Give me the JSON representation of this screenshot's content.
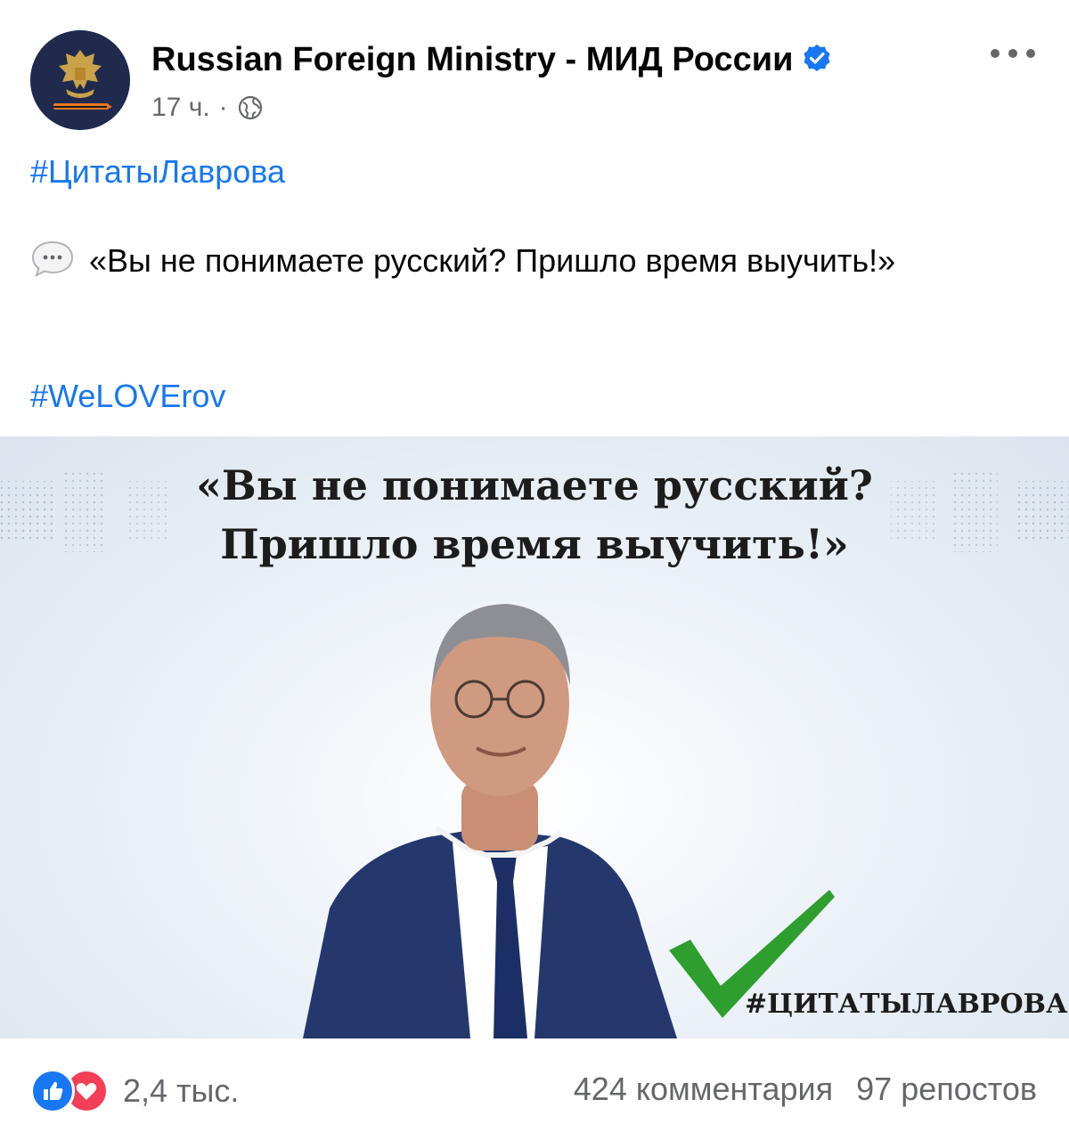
{
  "post": {
    "author": "Russian Foreign Ministry - МИД России",
    "verified": true,
    "timestamp": "17 ч.",
    "separator": "·",
    "audience_icon": "globe-icon",
    "hashtag_top": "#ЦитатыЛаврова",
    "quote_text": "«Вы не понимаете русский? Пришло время выучить!»",
    "hashtag_bottom": "#WeLOVErov"
  },
  "image": {
    "quote_line1": "«Вы не понимаете русский?",
    "quote_line2": "Пришло время выучить!»",
    "hashtag": "#ЦИТАТЫЛАВРОВА",
    "check_color": "#2e9e2e"
  },
  "footer": {
    "reaction_count": "2,4 тыс.",
    "comments": "424 комментария",
    "shares": "97 репостов"
  },
  "colors": {
    "link": "#1877f2",
    "secondary_text": "#65676b",
    "like": "#1877f2",
    "love": "#f33e58"
  }
}
